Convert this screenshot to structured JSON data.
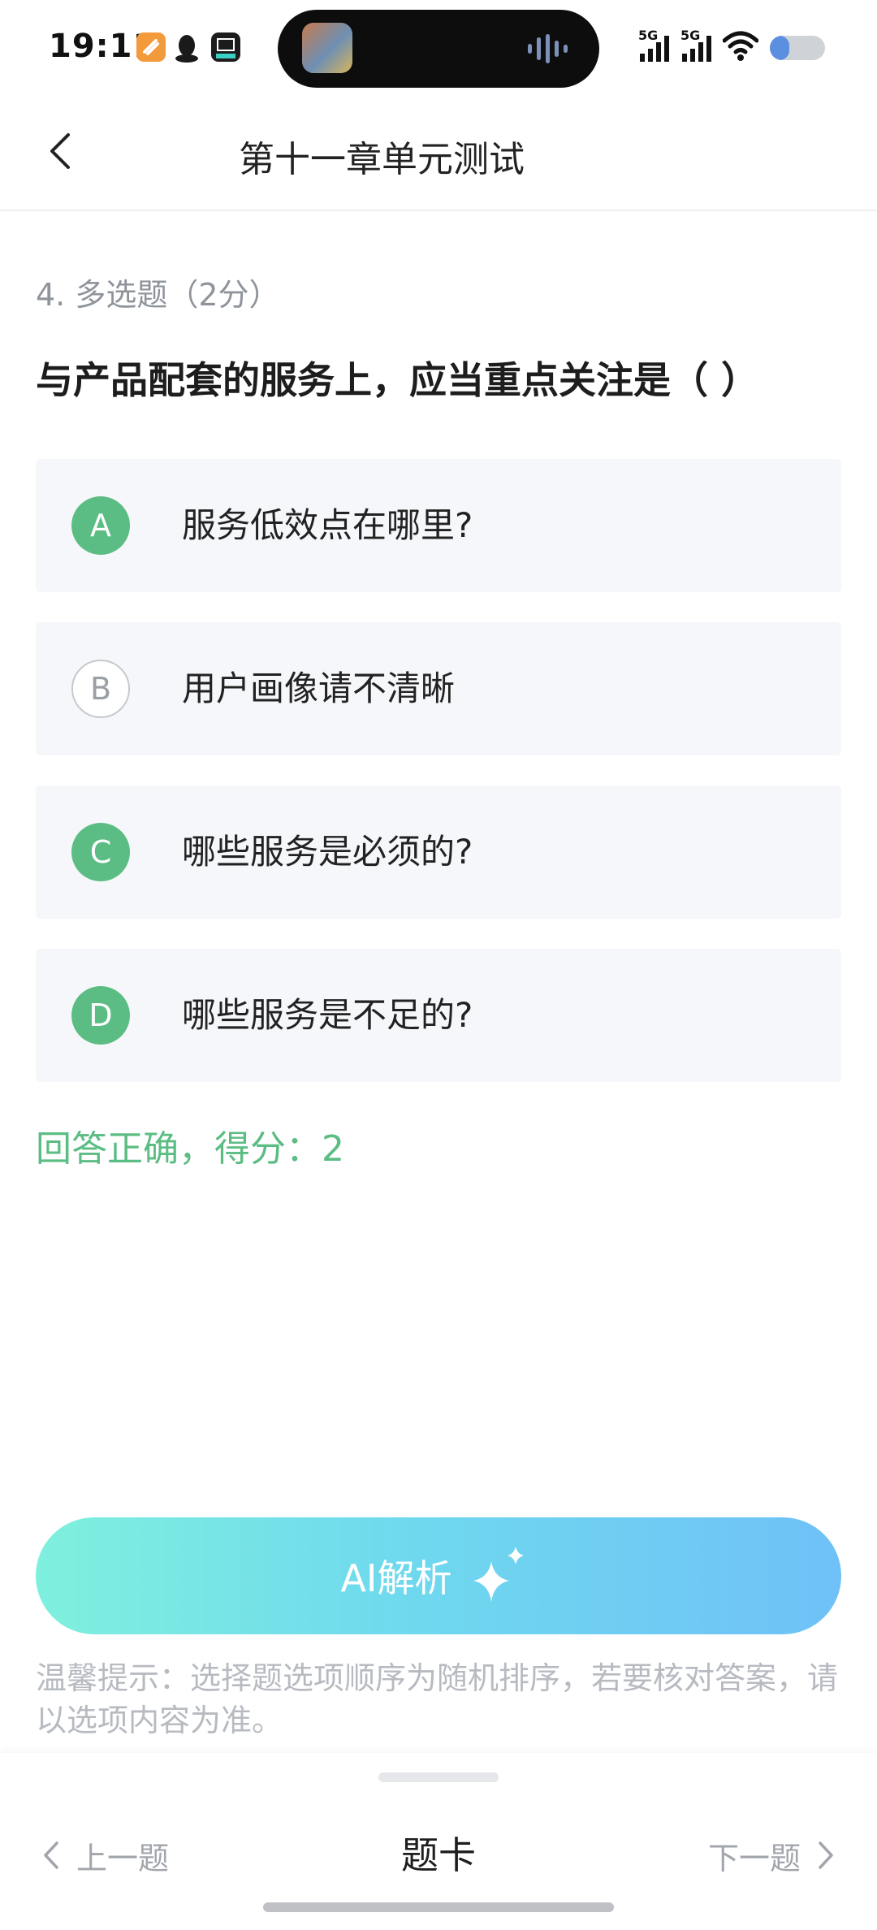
{
  "status": {
    "time": "19:11",
    "sig1": "5G",
    "sig2": "5G",
    "battery_level": 0.36
  },
  "header": {
    "title": "第十一章单元测试"
  },
  "question": {
    "meta": "4. 多选题（2分）",
    "text": "与产品配套的服务上，应当重点关注是（ ）",
    "options": [
      {
        "letter": "A",
        "text": "服务低效点在哪里?",
        "selected": true
      },
      {
        "letter": "B",
        "text": "用户画像请不清晰",
        "selected": false
      },
      {
        "letter": "C",
        "text": "哪些服务是必须的?",
        "selected": true
      },
      {
        "letter": "D",
        "text": "哪些服务是不足的?",
        "selected": true
      }
    ],
    "result": "回答正确，得分：2"
  },
  "ai_button": {
    "label": "AI解析"
  },
  "tip": "温馨提示：选择题选项顺序为随机排序，若要核对答案，请以选项内容为准。",
  "nav": {
    "prev": "上一题",
    "card": "题卡",
    "next": "下一题"
  },
  "colors": {
    "accent_green": "#5bbd83",
    "ai_gradient_start": "#7ff0dd",
    "ai_gradient_end": "#6fc1f7"
  }
}
